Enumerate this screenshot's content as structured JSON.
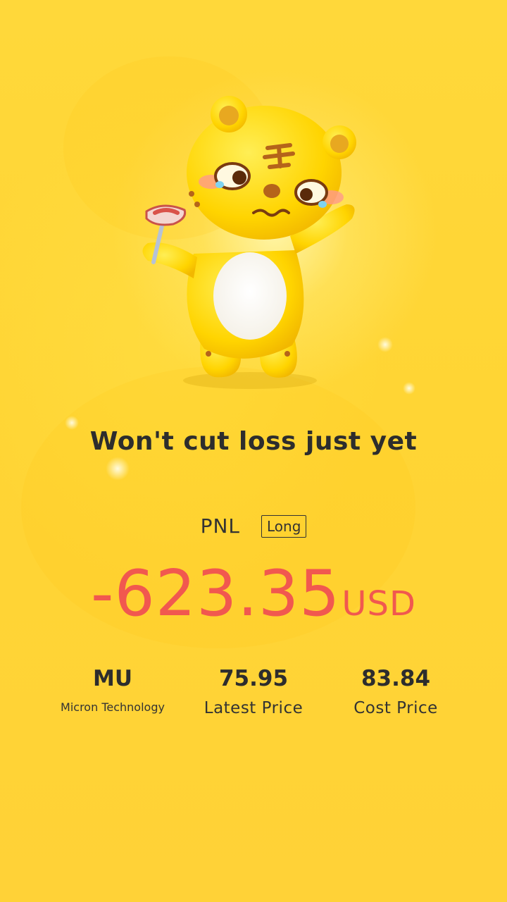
{
  "tagline": "Won't cut loss just yet",
  "pnl": {
    "label": "PNL",
    "side": "Long",
    "value": "-623.35",
    "unit": "USD"
  },
  "stock": {
    "symbol": "MU",
    "name": "Micron Technology"
  },
  "latest": {
    "value": "75.95",
    "label": "Latest Price"
  },
  "cost": {
    "value": "83.84",
    "label": "Cost Price"
  },
  "colors": {
    "background": "#ffd22e",
    "loss": "#f1584f",
    "text": "#2d2d2d"
  },
  "icons": {
    "mascot": "crying-tiger-mascot-icon"
  }
}
